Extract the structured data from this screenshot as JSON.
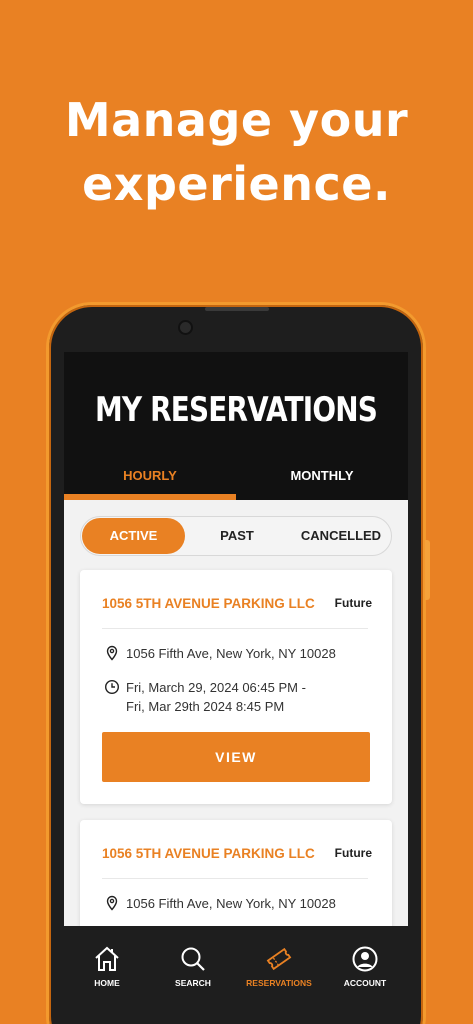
{
  "headline": {
    "line1": "Manage your",
    "line2": "experience."
  },
  "screen": {
    "title": "MY RESERVATIONS",
    "tabs": [
      {
        "label": "HOURLY",
        "active": true
      },
      {
        "label": "MONTHLY",
        "active": false
      }
    ],
    "filters": [
      {
        "label": "ACTIVE",
        "active": true
      },
      {
        "label": "PAST"
      },
      {
        "label": "CANCELLED"
      }
    ],
    "reservations": [
      {
        "name": "1056 5TH AVENUE PARKING LLC",
        "status": "Future",
        "address": "1056 Fifth Ave, New York, NY 10028",
        "time_line1": "Fri, March 29, 2024 06:45 PM -",
        "time_line2": "Fri, Mar 29th 2024 8:45 PM",
        "button": "VIEW"
      },
      {
        "name": "1056 5TH AVENUE PARKING LLC",
        "status": "Future",
        "address": "1056 Fifth Ave, New York, NY 10028"
      }
    ],
    "nav": [
      {
        "label": "HOME",
        "icon": "home-icon"
      },
      {
        "label": "SEARCH",
        "icon": "search-icon"
      },
      {
        "label": "RESERVATIONS",
        "icon": "ticket-icon",
        "active": true
      },
      {
        "label": "ACCOUNT",
        "icon": "account-icon"
      }
    ]
  },
  "colors": {
    "brand": "#E98123",
    "header": "#111111",
    "nav_bg": "#1E1E1E",
    "text": "#222222"
  }
}
